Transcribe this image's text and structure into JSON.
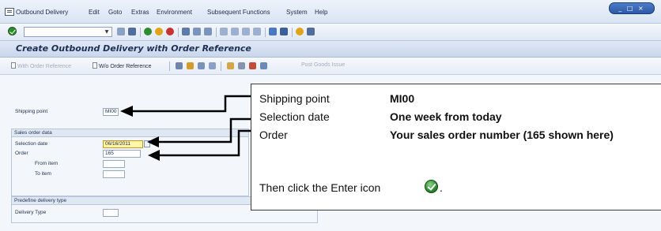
{
  "menubar": {
    "items": [
      "Outbound Delivery",
      "Edit",
      "Goto",
      "Extras",
      "Environment",
      "Subsequent Functions",
      "System",
      "Help"
    ]
  },
  "window_controls": {
    "label": "_ □ ×"
  },
  "standard_toolbar": {
    "command_field": {
      "value": "",
      "placeholder": ""
    }
  },
  "title": "Create Outbound Delivery with Order Reference",
  "app_toolbar": {
    "with_order_reference": "With Order Reference",
    "wo_order_reference": "W/o Order Reference",
    "post_goods_issue": "Post Goods Issue"
  },
  "form": {
    "shipping_point_label": "Shipping point",
    "shipping_point_value": "MI00",
    "sales_order_group": "Sales order data",
    "selection_date_label": "Selection date",
    "selection_date_value": "06/16/2011",
    "order_label": "Order",
    "order_value": "165",
    "from_item_label": "From item",
    "from_item_value": "",
    "to_item_label": "To item",
    "to_item_value": "",
    "delivery_type_group": "Predefine delivery type",
    "delivery_type_label": "Delivery Type",
    "delivery_type_value": ""
  },
  "callout": {
    "rows": [
      {
        "label": "Shipping point",
        "value": "MI00"
      },
      {
        "label": "Selection date",
        "value": "One week from today"
      },
      {
        "label": "Order",
        "value": "Your sales order number (165 shown here)"
      }
    ],
    "instruction": "Then click the Enter icon",
    "instruction_end": "."
  },
  "colors": {
    "highlight_field": "#fff6a8",
    "title_text": "#1d2f52",
    "enter_icon": "#2a8a2a"
  }
}
